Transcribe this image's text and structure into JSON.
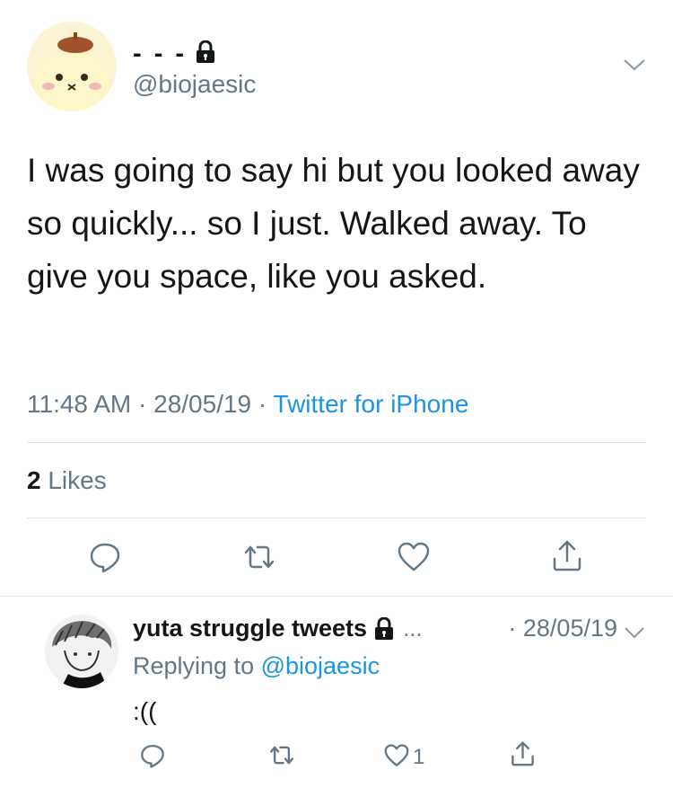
{
  "tweet": {
    "display_name": "- - -",
    "handle": "@biojaesic",
    "text": "I was going to say hi but you looked away so quickly... so I just. Walked away. To give you space, like you asked.",
    "time": "11:48 AM",
    "date": "28/05/19",
    "separator": " · ",
    "source": "Twitter for iPhone",
    "likes_count": "2",
    "likes_label": "Likes"
  },
  "actions": [
    "reply-icon",
    "retweet-icon",
    "heart-icon",
    "share-icon"
  ],
  "reply": {
    "display_name": "yuta struggle tweets",
    "ellipsis": "...",
    "date": "· 28/05/19",
    "replying_prefix": "Replying to ",
    "replying_to": "@biojaesic",
    "text": ":((",
    "like_count": "1"
  },
  "colors": {
    "text": "#14171a",
    "secondary": "#657786",
    "link": "#1b95e0",
    "divider": "#dfe3e6"
  }
}
